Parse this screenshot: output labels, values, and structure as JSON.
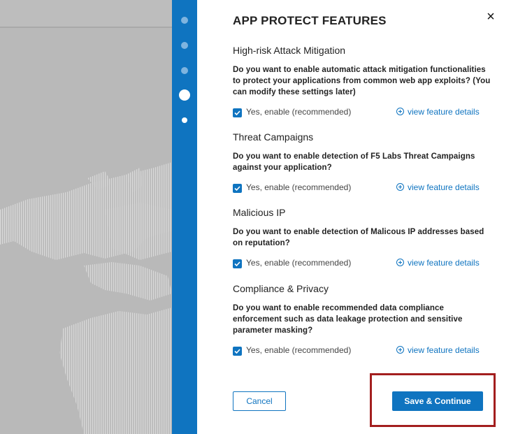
{
  "panel": {
    "title": "APP PROTECT FEATURES",
    "close_icon": "×"
  },
  "sections": [
    {
      "title": "High-risk Attack Mitigation",
      "description": "Do you want to enable automatic attack mitigation functionalities to protect your applications from common web app exploits? (You can modify these settings later)",
      "option_label": "Yes, enable (recommended)",
      "checked": true,
      "details_link": "view feature details"
    },
    {
      "title": "Threat Campaigns",
      "description": "Do you want to enable detection of F5 Labs Threat Campaigns against your application?",
      "option_label": "Yes, enable (recommended)",
      "checked": true,
      "details_link": "view feature details"
    },
    {
      "title": "Malicious IP",
      "description": "Do you want to enable detection of Malicous IP addresses based on reputation?",
      "option_label": "Yes, enable (recommended)",
      "checked": true,
      "details_link": "view feature details"
    },
    {
      "title": "Compliance & Privacy",
      "description": "Do you want to enable recommended data compliance enforcement such as data leakage protection and sensitive parameter masking?",
      "option_label": "Yes, enable (recommended)",
      "checked": true,
      "details_link": "view feature details"
    }
  ],
  "actions": {
    "cancel_label": "Cancel",
    "save_label": "Save & Continue"
  },
  "stepper": {
    "steps_total": 5,
    "current_step": 4
  },
  "colors": {
    "accent": "#0f74c0",
    "highlight_border": "#a31e1e",
    "backdrop": "#b9b9b9"
  }
}
